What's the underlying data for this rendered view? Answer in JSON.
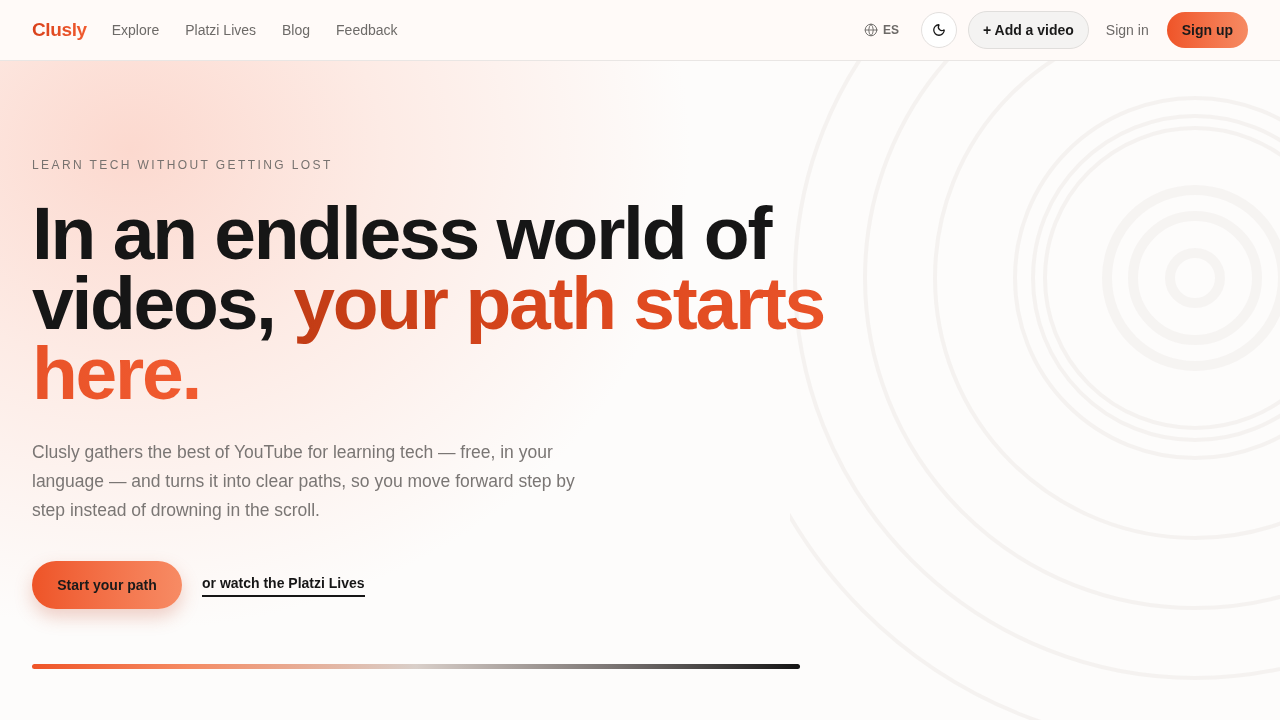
{
  "nav": {
    "logo": "Clusly",
    "links": [
      {
        "label": "Explore"
      },
      {
        "label": "Platzi Lives"
      },
      {
        "label": "Blog"
      },
      {
        "label": "Feedback"
      }
    ],
    "language": "ES",
    "add_video": "+ Add a video",
    "sign_in": "Sign in",
    "sign_up": "Sign up"
  },
  "hero": {
    "eyebrow": "LEARN TECH WITHOUT GETTING LOST",
    "headline": {
      "lead": "In an endless world of videos,",
      "highlight": "your path starts here."
    },
    "description": "Clusly gathers the best of YouTube for learning tech — free, in your language — and turns it into clear paths, so you move forward step by step instead of drowning in the scroll.",
    "primary_button": "Start your path",
    "secondary_link": "or watch the Platzi Lives"
  }
}
